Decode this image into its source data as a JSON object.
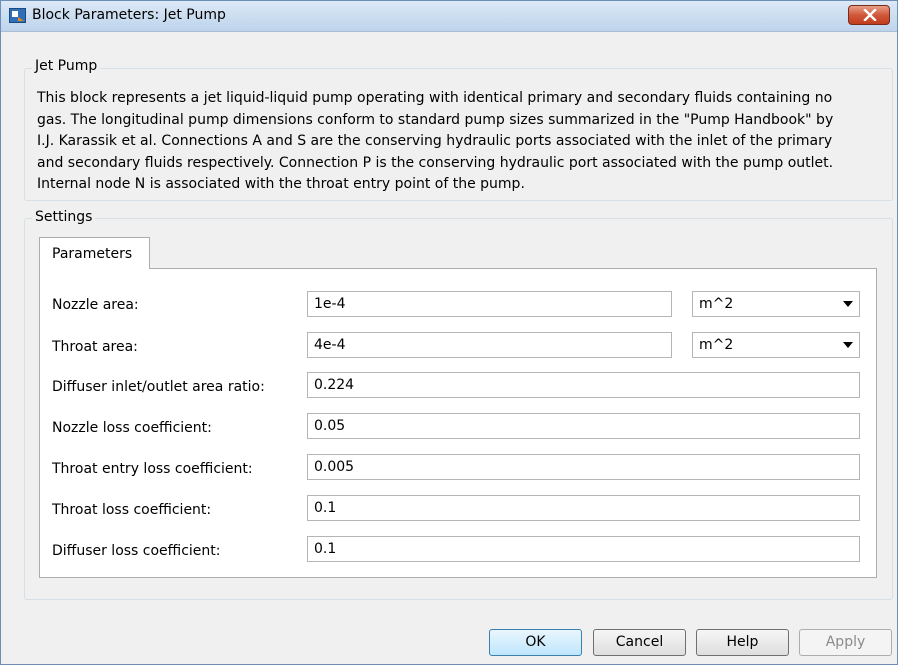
{
  "window": {
    "title": "Block Parameters: Jet Pump"
  },
  "description_group": {
    "label": "Jet Pump",
    "lines": [
      "This block represents a jet liquid-liquid pump operating with identical primary and secondary fluids containing no",
      "gas. The longitudinal pump dimensions conform to standard pump sizes summarized in the \"Pump Handbook\" by",
      "I.J. Karassik et al. Connections A and S are the conserving hydraulic ports associated with the inlet of the primary",
      "and secondary fluids respectively. Connection P is the conserving hydraulic port associated with the pump outlet.",
      "Internal node N is associated with the throat entry point of the pump."
    ]
  },
  "settings": {
    "label": "Settings",
    "tab_label": "Parameters",
    "params": [
      {
        "label": "Nozzle area:",
        "value": "1e-4",
        "unit": "m^2"
      },
      {
        "label": "Throat area:",
        "value": "4e-4",
        "unit": "m^2"
      },
      {
        "label": "Diffuser inlet/outlet area ratio:",
        "value": "0.224"
      },
      {
        "label": "Nozzle loss coefficient:",
        "value": "0.05"
      },
      {
        "label": "Throat entry loss coefficient:",
        "value": "0.005"
      },
      {
        "label": "Throat loss coefficient:",
        "value": "0.1"
      },
      {
        "label": "Diffuser loss coefficient:",
        "value": "0.1"
      }
    ]
  },
  "buttons": {
    "ok": "OK",
    "cancel": "Cancel",
    "help": "Help",
    "apply": "Apply"
  },
  "colors": {
    "titlebar": "#c9dcf0",
    "close_button": "#c23c1e",
    "dialog_bg": "#f0f0f0"
  },
  "icons": {
    "title": "simulink-block-icon",
    "close": "close-icon",
    "dropdown": "chevron-down-icon"
  }
}
